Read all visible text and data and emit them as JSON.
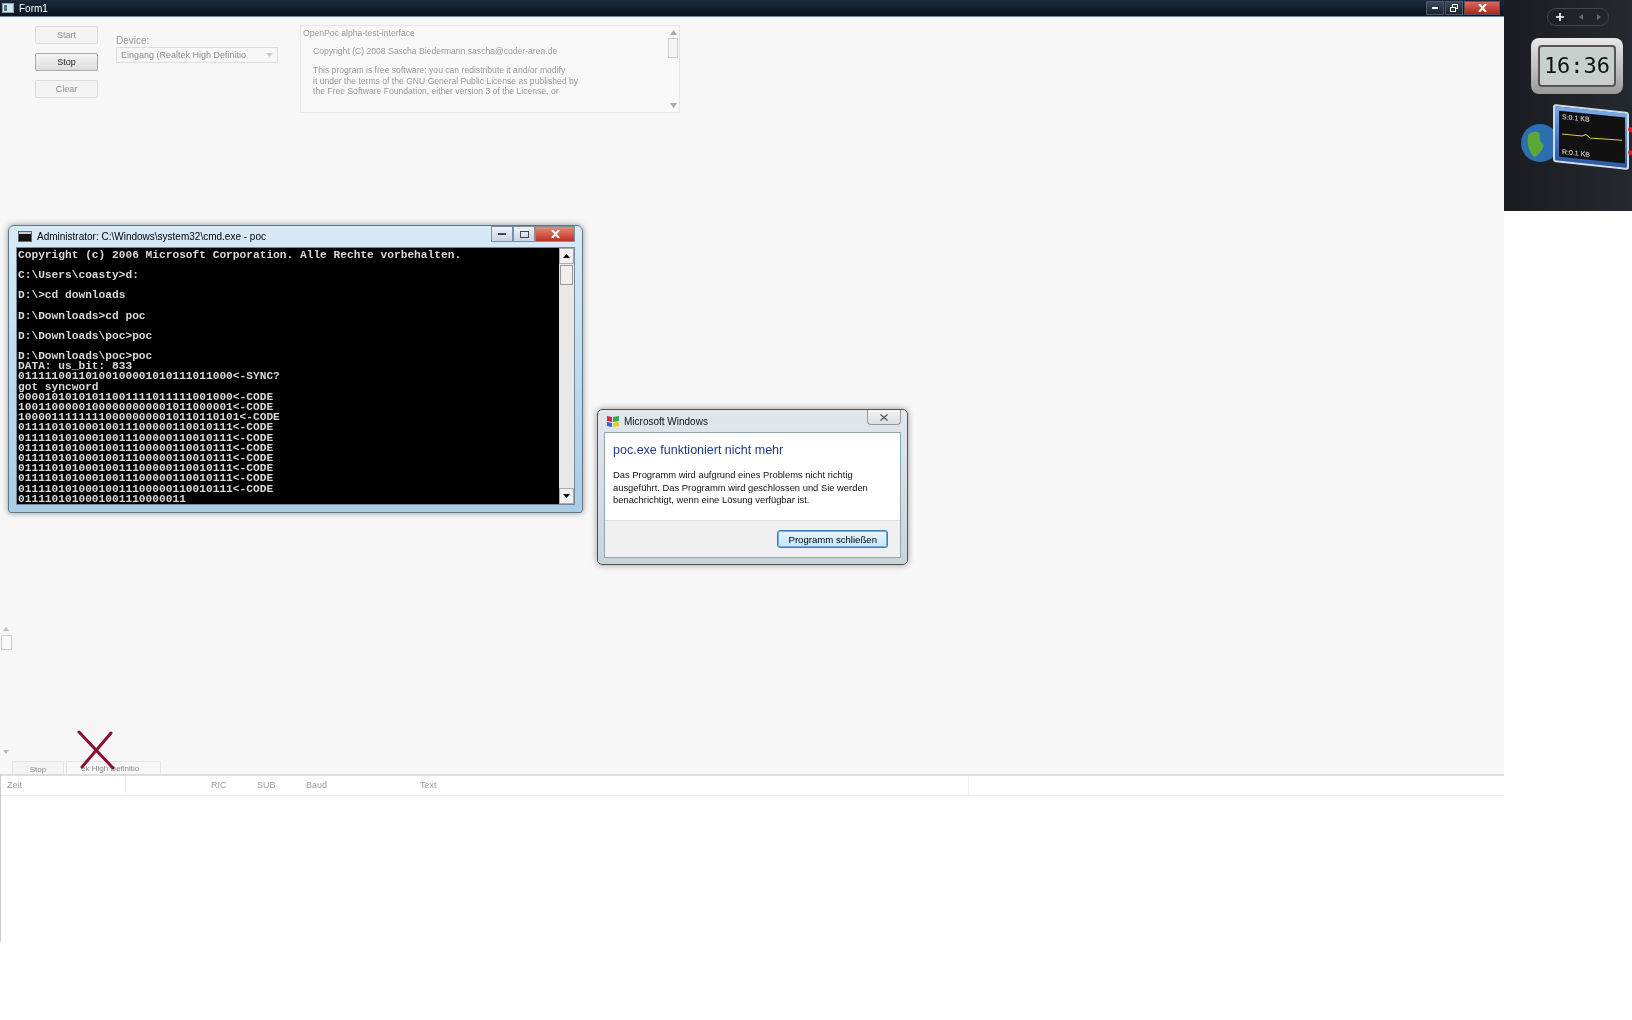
{
  "form": {
    "title": "Form1",
    "buttons": [
      {
        "label": "Start",
        "disabled": true
      },
      {
        "label": "Stop",
        "disabled": false
      },
      {
        "label": "Clear",
        "disabled": true
      }
    ],
    "device_label": "Device:",
    "device_dropdown": {
      "value": "Eingang (Realtek High Definitio",
      "disabled": true
    },
    "license_text": [
      "OpenPoc alpha-test-interface",
      "Copyright (C) 2008 Sascha Biedermann sascha@coder-area.de",
      "This program is free software: you can redistribute it and/or modify",
      "it under the terms of the GNU General Public License as published by",
      "the Free Software Foundation, either version 3 of the License, or"
    ],
    "ghost_button": "Stop",
    "ghost_dropdown": "ek High Definitio",
    "list_columns": [
      "Zeit",
      "RIC",
      "SUB",
      "Baud",
      "Text"
    ]
  },
  "console": {
    "title": "Administrator: C:\\Windows\\system32\\cmd.exe - poc",
    "blocks": [
      [
        "Copyright (c) 2006 Microsoft Corporation. Alle Rechte vorbehalten."
      ],
      [
        "C:\\Users\\coasty>d:"
      ],
      [
        "D:\\>cd downloads"
      ],
      [
        "D:\\Downloads>cd poc"
      ],
      [
        "D:\\Downloads\\poc>poc"
      ],
      [
        "D:\\Downloads\\poc>poc",
        "DATA: us_bit: 833",
        "01111100110100100001010111011000<-SYNC?",
        "got syncword",
        "00001010101011001111011111001000<-CODE",
        "10011000001000000000001011000001<-CODE",
        "100001111111100000000010110110101<-CODE",
        "01111010100010011100000110010111<-CODE",
        "01111010100010011100000110010111<-CODE",
        "01111010100010011100000110010111<-CODE",
        "01111010100010011100000110010111<-CODE",
        "01111010100010011100000110010111<-CODE",
        "01111010100010011100000110010111<-CODE",
        "01111010100010011100000110010111<-CODE",
        "0111101010001001110000011"
      ]
    ]
  },
  "dialog": {
    "title": "Microsoft Windows",
    "heading": "poc.exe funktioniert nicht mehr",
    "message": "Das Programm wird aufgrund eines Problems nicht richtig ausgeführt. Das Programm wird geschlossen und Sie werden benachrichtigt, wenn eine Lösung verfügbar ist.",
    "button": "Programm schließen"
  },
  "gadgets": {
    "clock": "16:36",
    "sent": "S:0.1 KB",
    "received": "R:0.1 KB"
  }
}
